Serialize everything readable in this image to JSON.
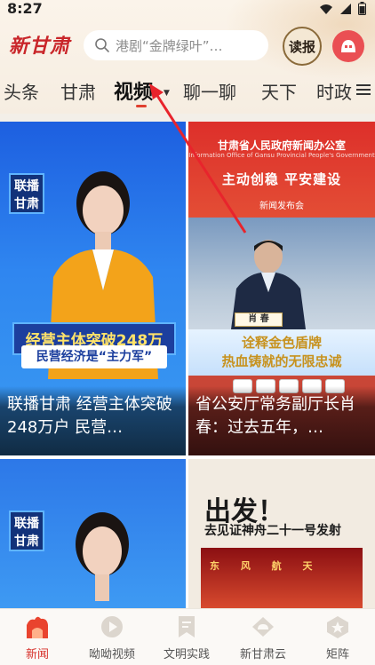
{
  "status_bar": {
    "time": "8:27"
  },
  "header": {
    "logo_text": "新甘肃",
    "search_placeholder": "港剧“金牌绿叶”…",
    "read_paper_label": "读报"
  },
  "tabs": {
    "items": [
      "头条",
      "甘肃",
      "视频",
      "聊一聊",
      "天下",
      "时政"
    ],
    "active_index": 2
  },
  "feed": {
    "cards": [
      {
        "caption": "联播甘肃 经营主体突破248万户  民营…",
        "badge": "联播甘肃",
        "overlay_main": "经营主体突破248万",
        "overlay_sub": "民营经济是“主力军”"
      },
      {
        "caption": "省公安厅常务副厅长肖春：过去五年，…",
        "org": "甘肃省人民政府新闻办公室",
        "org_en": "Information Office of Gansu Provincial People's Government",
        "slogan": "主动创稳  平安建设",
        "event": "新闻发布会",
        "nameplate": "肖 春",
        "banner_line1": "诠释金色盾牌",
        "banner_line2": "热血铸就的无限忠诚"
      },
      {
        "caption": "",
        "badge": "联播甘肃"
      },
      {
        "caption": "",
        "headline": "出发！",
        "subline": "去见证神舟二十一号发射",
        "photo_text": "东 风 航 天"
      }
    ]
  },
  "bottom_nav": {
    "items": [
      {
        "label": "新闻",
        "icon": "news-icon",
        "active": true
      },
      {
        "label": "呦呦视频",
        "icon": "play-icon",
        "active": false
      },
      {
        "label": "文明实践",
        "icon": "bookmark-icon",
        "active": false
      },
      {
        "label": "新甘肃云",
        "icon": "cloud-icon",
        "active": false
      },
      {
        "label": "矩阵",
        "icon": "star-icon",
        "active": false
      }
    ]
  },
  "colors": {
    "brand_red": "#c9262a",
    "active_tab_underline": "#e0402f",
    "nav_active": "#d7312b"
  }
}
